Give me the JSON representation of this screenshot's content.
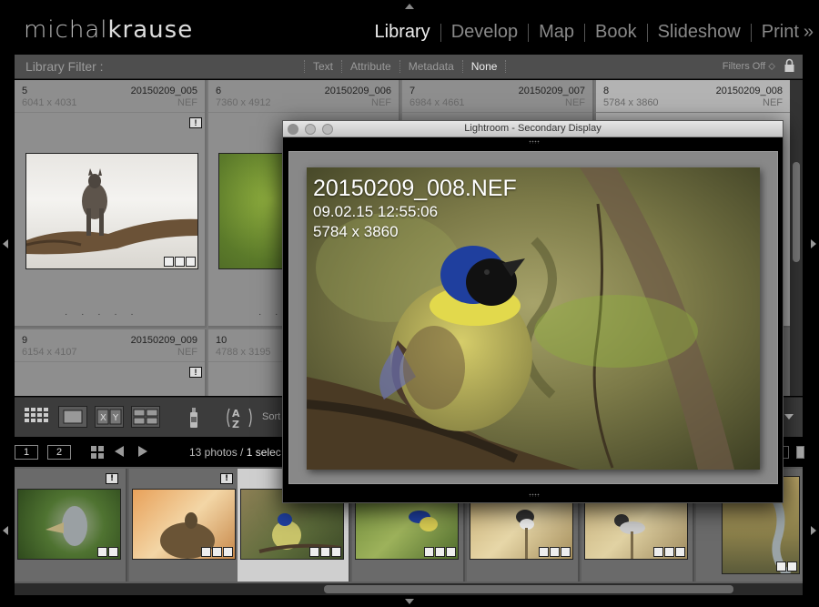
{
  "identity_plate": {
    "first": "michal",
    "second": "krause"
  },
  "modules": [
    {
      "label": "Library",
      "active": true
    },
    {
      "label": "Develop",
      "active": false
    },
    {
      "label": "Map",
      "active": false
    },
    {
      "label": "Book",
      "active": false
    },
    {
      "label": "Slideshow",
      "active": false
    },
    {
      "label": "Print",
      "active": false
    }
  ],
  "module_more": "»",
  "library_filter": {
    "title": "Library Filter :",
    "options": [
      "Text",
      "Attribute",
      "Metadata",
      "None"
    ],
    "active": "None",
    "preset": "Filters Off ⬦"
  },
  "grid": {
    "cells": [
      {
        "index": "5",
        "name": "20150209_005",
        "dims": "6041 x 4031",
        "ext": "NEF",
        "selected": false
      },
      {
        "index": "6",
        "name": "20150209_006",
        "dims": "7360 x 4912",
        "ext": "NEF",
        "selected": false
      },
      {
        "index": "7",
        "name": "20150209_007",
        "dims": "6984 x 4661",
        "ext": "NEF",
        "selected": false
      },
      {
        "index": "8",
        "name": "20150209_008",
        "dims": "5784 x 3860",
        "ext": "NEF",
        "selected": true
      },
      {
        "index": "9",
        "name": "20150209_009",
        "dims": "6154 x 4107",
        "ext": "NEF",
        "selected": false
      },
      {
        "index": "10",
        "name": "",
        "dims": "4788 x 3195",
        "ext": "",
        "selected": false
      }
    ],
    "badge": "!",
    "rating_dots": "· · · · ·"
  },
  "toolbar": {
    "sort_label": "Sort"
  },
  "filmstrip_header": {
    "display1": "1",
    "display2": "2",
    "count": "13 photos /",
    "selected": "1 selec"
  },
  "secondary_display": {
    "title": "Lightroom - Secondary Display",
    "filename": "20150209_008.NEF",
    "datetime": "09.02.15 12:55:06",
    "dims": "5784 x 3860"
  },
  "colors": {
    "accent_bird_blue": "#1f3f9e",
    "bird_yellow": "#e3d64a",
    "panel_gray": "#8e8e8e",
    "selected_gray": "#b3b3b3"
  }
}
